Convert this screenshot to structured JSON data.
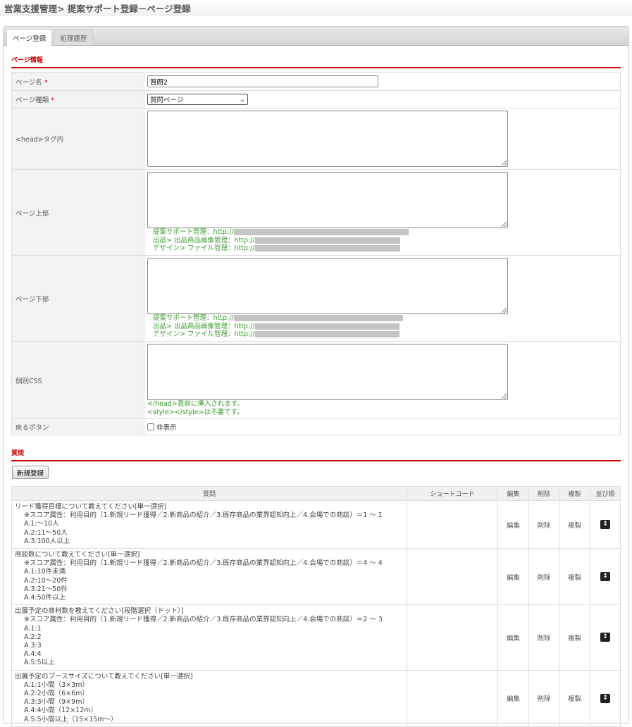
{
  "header": {
    "title": "営業支援管理> 提案サポート登録－ページ登録"
  },
  "tabs": [
    {
      "label": "ページ登録"
    },
    {
      "label": "処理履歴"
    }
  ],
  "page_info": {
    "section_title": "ページ情報",
    "required_mark": "*",
    "page_name": {
      "label": "ページ名",
      "value": "質問2"
    },
    "page_type": {
      "label": "ページ種類",
      "value": "質問ページ"
    },
    "head_tag": {
      "label": "<head>タグ内",
      "value": ""
    },
    "page_top": {
      "label": "ページ上部",
      "value": ""
    },
    "page_bottom": {
      "label": "ページ下部",
      "value": ""
    },
    "links": [
      "提案サポート管理：http://",
      "出品> 出品商品画像管理：http://",
      "デザイン> ファイル管理：http://"
    ],
    "css": {
      "label": "個別CSS",
      "value": "",
      "hint1": "</head>直前に挿入されます。",
      "hint2": "<style></style>は不要です。"
    },
    "back_button": {
      "label": "戻るボタン",
      "checkbox_label": "非表示",
      "checked": false
    }
  },
  "questions": {
    "section_title": "質問",
    "new_button": "新規登録",
    "columns": [
      "質問",
      "ショートコード",
      "編集",
      "削除",
      "複製",
      "並び順"
    ],
    "action_edit": "編集",
    "action_delete": "削除",
    "action_copy": "複製",
    "rows": [
      {
        "title": "リード獲得目標について教えてください[単一選択]",
        "score": "※スコア属性：利用目的（1.新規リード獲得／2.新商品の紹介／3.既存商品の業界認知向上／4.会場での商談）＝1 ～ 1",
        "answers": [
          "A.1:～10人",
          "A.2:11～50人",
          "A.3:100人以上"
        ]
      },
      {
        "title": "商談数について教えてください[単一選択]",
        "score": "※スコア属性：利用目的（1.新規リード獲得／2.新商品の紹介／3.既存商品の業界認知向上／4.会場での商談）＝4 ～ 4",
        "answers": [
          "A.1:10件未満",
          "A.2:10～20件",
          "A.3:21～50件",
          "A.4:50件以上"
        ]
      },
      {
        "title": "出展予定の商材数を教えてください[段階選択（ドット）]",
        "score": "※スコア属性：利用目的（1.新規リード獲得／2.新商品の紹介／3.既存商品の業界認知向上／4.会場での商談）＝2 ～ 3",
        "answers": [
          "A.1:1",
          "A.2:2",
          "A.3:3",
          "A.4:4",
          "A.5:5以上"
        ]
      },
      {
        "title": "出展予定のブースサイズについて教えてください[単一選択]",
        "score": "",
        "answers": [
          "A.1:1小間（3×3m）",
          "A.2:2小間（6×6m）",
          "A.3:3小間（9×9m）",
          "A.4:4小間（12×12m）",
          "A.5:5小間以上（15×15m～）"
        ]
      }
    ]
  }
}
